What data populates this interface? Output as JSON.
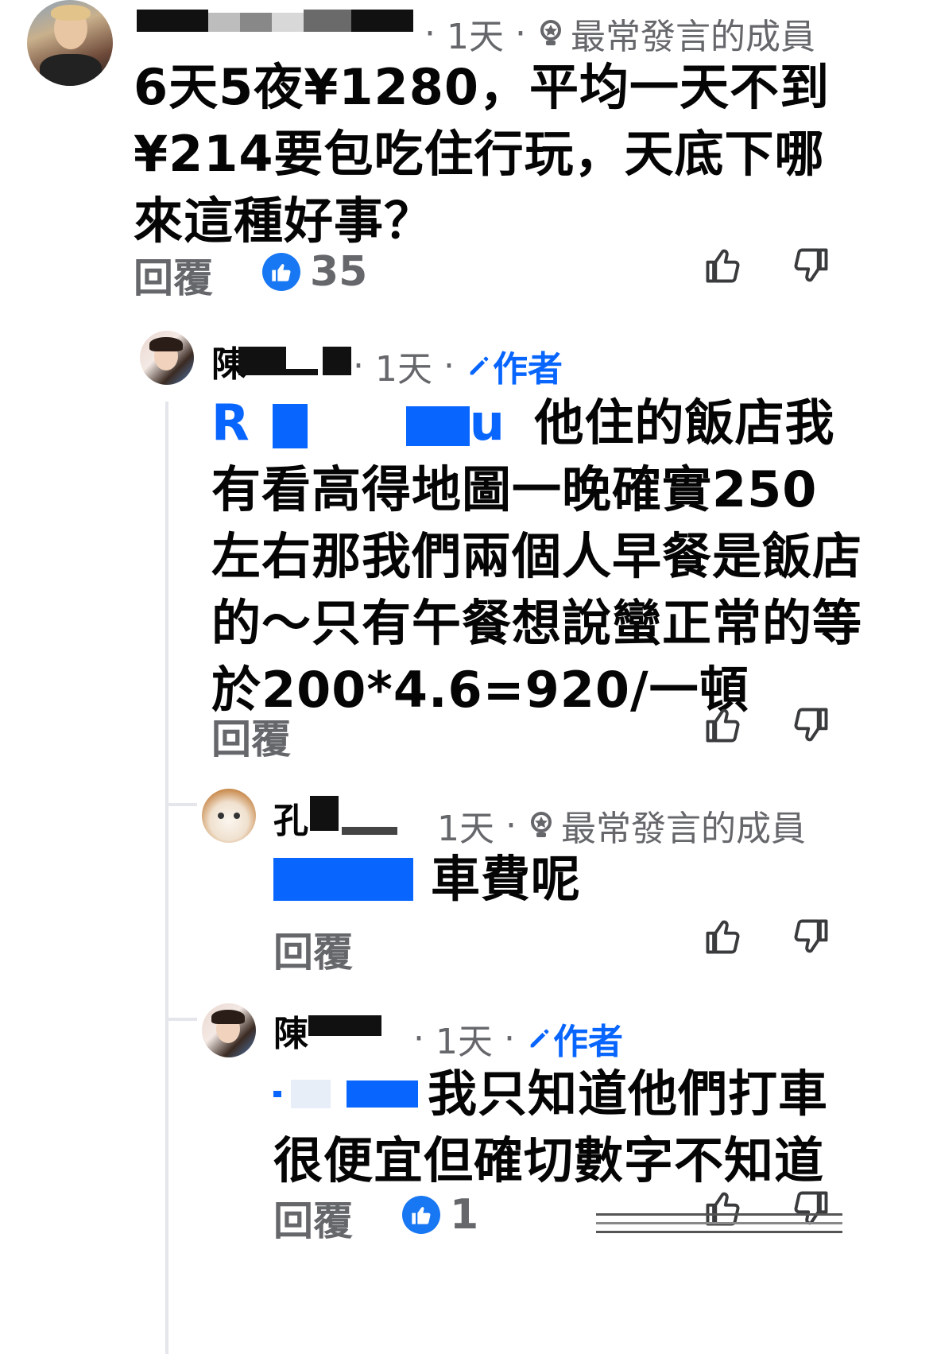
{
  "comments": [
    {
      "time": "1天",
      "badge_label": "最常發言的成員",
      "lines": [
        "6天5夜¥1280，平均一天不到",
        "¥214要包吃住行玩，天底下哪",
        "來這種好事？"
      ],
      "reply_label": "回覆",
      "like_count": "35"
    },
    {
      "name_visible": "陳",
      "time": "1天",
      "author_label": "作者",
      "mention_prefix": "R",
      "mention_suffix": "u",
      "lines": [
        "他住的飯店我",
        "有看高得地圖一晚確實250",
        "左右那我們兩個人早餐是飯店",
        "的～只有午餐想說蠻正常的等",
        "於200*4.6=920/一頓"
      ],
      "reply_label": "回覆"
    },
    {
      "name_visible": "孔",
      "time": "1天",
      "badge_label": "最常發言的成員",
      "lines": [
        "車費呢"
      ],
      "reply_label": "回覆"
    },
    {
      "name_visible": "陳",
      "time": "1天",
      "author_label": "作者",
      "lines": [
        "我只知道他們打車",
        "很便宜但確切數字不知道"
      ],
      "reply_label": "回覆",
      "like_count": "1"
    }
  ],
  "icons": {
    "like": "thumbs-up-icon",
    "dislike": "thumbs-down-icon",
    "badge": "top-contributor-icon",
    "author": "pencil-icon"
  },
  "colors": {
    "accent": "#0866ff",
    "muted": "#65676b",
    "like_bubble": "#1877f2"
  }
}
